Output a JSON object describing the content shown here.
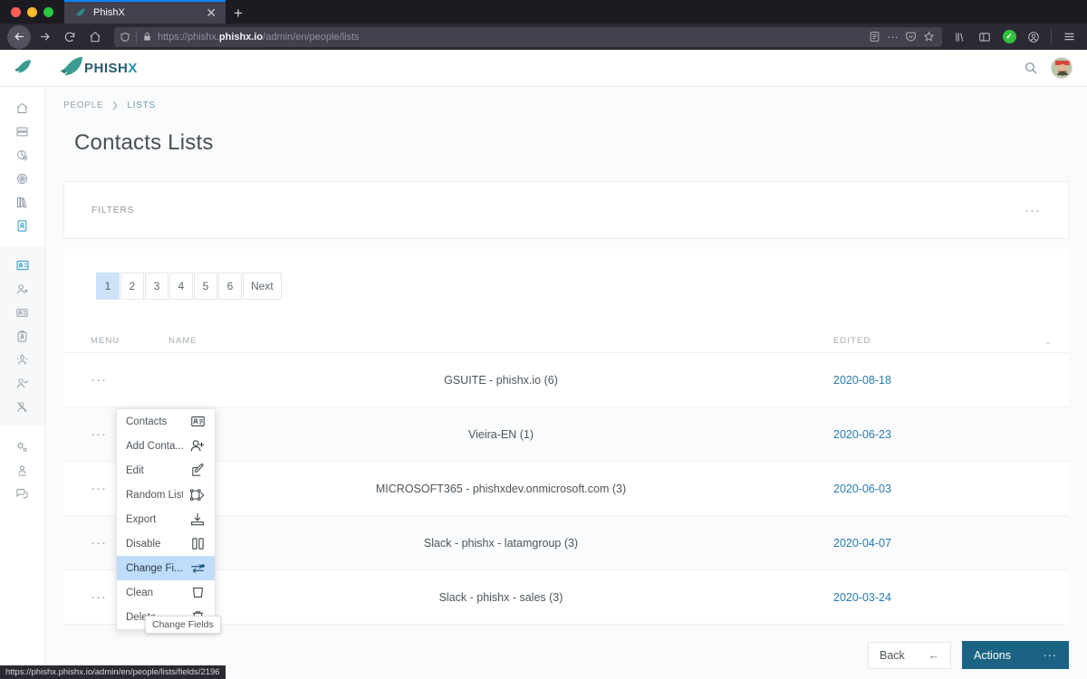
{
  "browser": {
    "tab_title": "PhishX",
    "tab_close": "✕",
    "new_tab": "+",
    "url_prefix": "https://phishx.",
    "url_domain": "phishx.io",
    "url_path": "/admin/en/people/lists",
    "status_url": "https://phishx.phishx.io/admin/en/people/lists/fields/2196",
    "accent": "#0a84ff"
  },
  "header": {
    "logo_text_main": "PHISH",
    "logo_text_accent": "X",
    "brand_color": "#2a5c6e",
    "accent_color": "#1c8fb0"
  },
  "sidebar": {
    "items": [
      {
        "name": "home",
        "active": false
      },
      {
        "name": "servers",
        "active": false
      },
      {
        "name": "clock-chart",
        "active": false
      },
      {
        "name": "target",
        "active": false
      },
      {
        "name": "books",
        "active": false
      },
      {
        "name": "contact-book",
        "active": true
      },
      {
        "name": "id-card",
        "active": true
      },
      {
        "name": "user-settings",
        "active": false
      },
      {
        "name": "id-badge",
        "active": false
      },
      {
        "name": "badge-card",
        "active": false
      },
      {
        "name": "user-group",
        "active": false
      },
      {
        "name": "user-check",
        "active": false
      },
      {
        "name": "user-disabled",
        "active": false
      },
      {
        "name": "gears",
        "active": false
      },
      {
        "name": "user-profile",
        "active": false
      },
      {
        "name": "chat",
        "active": false
      }
    ]
  },
  "breadcrumb": {
    "items": [
      "PEOPLE",
      "LISTS"
    ],
    "separator": "❯"
  },
  "page": {
    "title": "Contacts Lists"
  },
  "filters": {
    "label": "FILTERS",
    "more": "···"
  },
  "pagination": {
    "pages": [
      "1",
      "2",
      "3",
      "4",
      "5",
      "6"
    ],
    "next_label": "Next",
    "active_page": "1"
  },
  "table": {
    "columns": {
      "menu": "MENU",
      "name": "NAME",
      "edited": "EDITED"
    },
    "sort_icon": "⌄",
    "row_menu_dots": "···",
    "rows": [
      {
        "name": "GSUITE - phishx.io (6)",
        "edited": "2020-08-18",
        "icon": ""
      },
      {
        "name": "Vieira-EN (1)",
        "edited": "2020-06-23",
        "icon": ""
      },
      {
        "name": "MICROSOFT365 - phishxdev.onmicrosoft.com (3)",
        "edited": "2020-06-03",
        "icon": ""
      },
      {
        "name": "Slack - phishx - latamgroup (3)",
        "edited": "2020-04-07",
        "icon": ""
      },
      {
        "name": "Slack - phishx - sales (3)",
        "edited": "2020-03-24",
        "icon": "slack-icon"
      }
    ]
  },
  "context_menu": {
    "items": [
      {
        "label": "Contacts",
        "icon": "contact-card-icon",
        "highlight": false
      },
      {
        "label": "Add Conta...",
        "icon": "add-user-icon",
        "highlight": false
      },
      {
        "label": "Edit",
        "icon": "edit-pencil-icon",
        "highlight": false
      },
      {
        "label": "Random List",
        "icon": "random-list-icon",
        "highlight": false
      },
      {
        "label": "Export",
        "icon": "export-download-icon",
        "highlight": false
      },
      {
        "label": "Disable",
        "icon": "pause-disable-icon",
        "highlight": false
      },
      {
        "label": "Change Fi...",
        "icon": "change-fields-icon",
        "highlight": true
      },
      {
        "label": "Clean",
        "icon": "clean-bucket-icon",
        "highlight": false
      },
      {
        "label": "Delete",
        "icon": "trash-icon",
        "highlight": false
      }
    ],
    "tooltip": "Change Fields"
  },
  "footer": {
    "back_label": "Back",
    "back_icon": "←",
    "actions_label": "Actions",
    "actions_icon": "···",
    "actions_color": "#1a6383"
  }
}
